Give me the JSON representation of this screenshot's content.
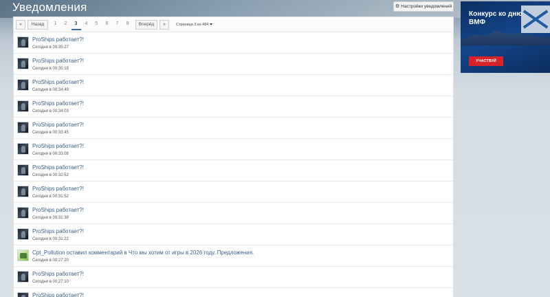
{
  "page": {
    "title": "Уведомления"
  },
  "toolbar": {
    "settings_label": "Настройки уведомлений",
    "settings_icon": "gear-icon"
  },
  "pager": {
    "first_label": "«",
    "back_label": "Назад",
    "pages": [
      "1",
      "2",
      "3",
      "4",
      "5",
      "6",
      "7",
      "8"
    ],
    "current_page": "3",
    "forward_label": "Вперёд",
    "last_label": "»",
    "status": "Страница 3 из 484"
  },
  "notifications": [
    {
      "title": "ProShips работает?!",
      "time": "Сегодня в 00:35:27",
      "avatar": "proships"
    },
    {
      "title": "ProShips работает?!",
      "time": "Сегодня в 00:35:18",
      "avatar": "proships"
    },
    {
      "title": "ProShips работает?!",
      "time": "Сегодня в 00:34:49",
      "avatar": "proships"
    },
    {
      "title": "ProShips работает?!",
      "time": "Сегодня в 00:34:03",
      "avatar": "proships"
    },
    {
      "title": "ProShips работает?!",
      "time": "Сегодня в 00:33:45",
      "avatar": "proships"
    },
    {
      "title": "ProShips работает?!",
      "time": "Сегодня в 00:33:08",
      "avatar": "proships"
    },
    {
      "title": "ProShips работает?!",
      "time": "Сегодня в 00:32:52",
      "avatar": "proships"
    },
    {
      "title": "ProShips работает?!",
      "time": "Сегодня в 00:31:52",
      "avatar": "proships"
    },
    {
      "title": "ProShips работает?!",
      "time": "Сегодня в 00:31:38",
      "avatar": "proships"
    },
    {
      "title": "ProShips работает?!",
      "time": "Сегодня в 00:31:22",
      "avatar": "proships"
    },
    {
      "title": "Cpt_Pollution оставил комментарий в Что мы хотим от игры в 2026 году. Предложения.",
      "time": "Сегодня в 00:27:20",
      "avatar": "cpt_pollution"
    },
    {
      "title": "ProShips работает?!",
      "time": "Сегодня в 00:27:10",
      "avatar": "proships"
    },
    {
      "title": "ProShips работает?!",
      "time": "",
      "avatar": "proships"
    }
  ],
  "ad": {
    "title": "Конкурс ко дню ВМФ",
    "button_label": "УЧАСТВУЙ",
    "colors": {
      "background": "#14458b",
      "button": "#d8232a"
    }
  },
  "colors": {
    "link": "#3a5f8f",
    "accent": "#3b6aa0"
  }
}
